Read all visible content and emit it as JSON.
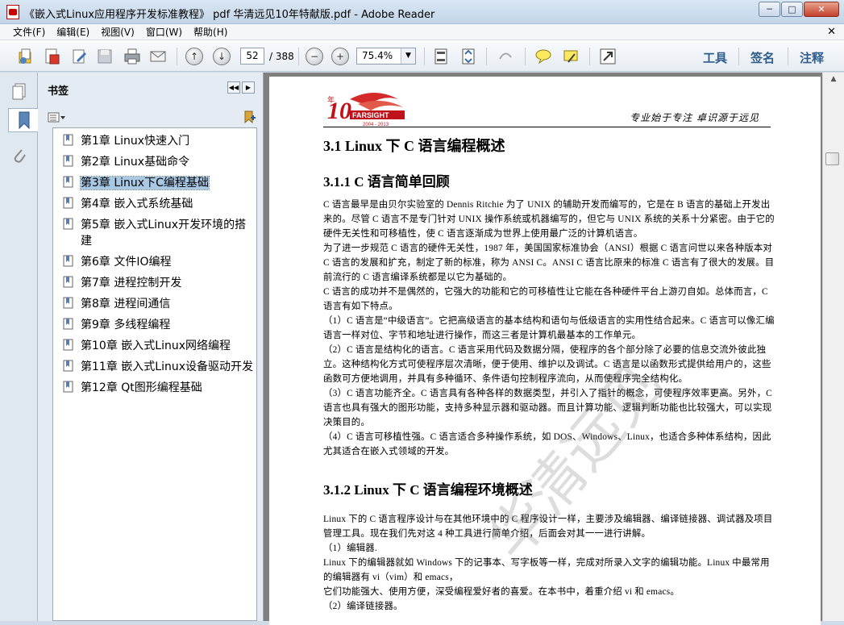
{
  "window": {
    "title": "《嵌入式Linux应用程序开发标准教程》 pdf 华清远见10年特献版.pdf - Adobe Reader"
  },
  "menu": [
    "文件(F)",
    "编辑(E)",
    "视图(V)",
    "窗口(W)",
    "帮助(H)"
  ],
  "toolbar": {
    "page_current": "52",
    "page_total": "/ 388",
    "zoom": "75.4%",
    "tools_label": "工具",
    "sign_label": "签名",
    "comment_label": "注释"
  },
  "bookmarks": {
    "title": "书签",
    "items": [
      "第1章  Linux快速入门",
      "第2章  Linux基础命令",
      "第3章  Linux下C编程基础",
      "第4章  嵌入式系统基础",
      "第5章  嵌入式Linux开发环境的搭建",
      "第6章  文件IO编程",
      "第7章  进程控制开发",
      "第8章  进程间通信",
      "第9章  多线程编程",
      "第10章  嵌入式Linux网络编程",
      "第11章  嵌入式Linux设备驱动开发",
      "第12章  Qt图形编程基础"
    ],
    "selected_index": 2
  },
  "document": {
    "logo_text": "10年 FARSIGHT 2004-2013",
    "slogan": "专业始于专注  卓识源于远见",
    "heading1": "3.1    Linux 下 C 语言编程概述",
    "heading2a": "3.1.1    C 语言简单回顾",
    "section1": [
      "C 语言最早是由贝尔实验室的 Dennis Ritchie 为了 UNIX 的辅助开发而编写的，它是在 B 语言的基础上开发出来的。尽管 C 语言不是专门针对 UNIX 操作系统或机器编写的，但它与 UNIX 系统的关系十分紧密。由于它的硬件无关性和可移植性，使 C 语言逐渐成为世界上使用最广泛的计算机语言。",
      "为了进一步规范 C 语言的硬件无关性，1987 年，美国国家标准协会（ANSI）根据 C 语言问世以来各种版本对 C 语言的发展和扩充，制定了新的标准，称为 ANSI C。ANSI C 语言比原来的标准 C 语言有了很大的发展。目前流行的 C 语言编译系统都是以它为基础的。",
      "C 语言的成功并不是偶然的，它强大的功能和它的可移植性让它能在各种硬件平台上游刃自如。总体而言，C 语言有如下特点。",
      "（1）C 语言是“中级语言”。它把高级语言的基本结构和语句与低级语言的实用性结合起来。C 语言可以像汇编语言一样对位、字节和地址进行操作，而这三者是计算机最基本的工作单元。",
      "（2）C 语言是结构化的语言。C 语言采用代码及数据分隔，使程序的各个部分除了必要的信息交流外彼此独立。这种结构化方式可使程序层次清晰，便于使用、维护以及调试。C 语言是以函数形式提供给用户的，这些函数可方便地调用，并具有多种循环、条件语句控制程序流向，从而使程序完全结构化。",
      "（3）C 语言功能齐全。C 语言具有各种各样的数据类型，并引入了指针的概念，可使程序效率更高。另外，C 语言也具有强大的图形功能，支持多种显示器和驱动器。而且计算功能、逻辑判断功能也比较强大，可以实现决策目的。",
      "（4）C 语言可移植性强。C 语言适合多种操作系统，如 DOS、Windows、Linux，也适合多种体系结构，因此尤其适合在嵌入式领域的开发。"
    ],
    "heading2b": "3.1.2    Linux 下 C 语言编程环境概述",
    "section2": [
      "Linux 下的 C 语言程序设计与在其他环境中的 C 程序设计一样，主要涉及编辑器、编译链接器、调试器及项目管理工具。现在我们先对这 4 种工具进行简单介绍，后面会对其一一进行讲解。",
      "（1）编辑器.",
      "Linux 下的编辑器就如 Windows 下的记事本、写字板等一样，完成对所录入文字的编辑功能。Linux 中最常用的编辑器有 vi（vim）和 emacs，",
      "它们功能强大、使用方便，深受编程爱好者的喜爱。在本书中，着重介绍 vi 和 emacs。",
      "（2）编译链接器。"
    ],
    "watermark": "华清远见"
  }
}
